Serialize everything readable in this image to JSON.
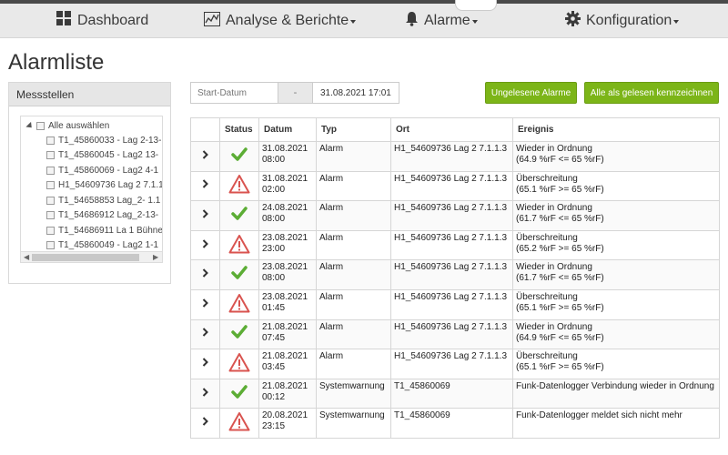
{
  "nav": {
    "dashboard": "Dashboard",
    "analyse": "Analyse & Berichte",
    "alarme": "Alarme",
    "konfiguration": "Konfiguration"
  },
  "page": {
    "title": "Alarmliste"
  },
  "messstellen": {
    "title": "Messstellen",
    "select_all": "Alle auswählen",
    "items": [
      "T1_45860033 - Lag 2-13-",
      "T1_45860045 - Lag2 13-",
      "T1_45860069 - Lag2 4-1",
      "H1_54609736 Lag 2 7.1.1",
      "T1_54658853 Lag_2- 1.1",
      "T1_54686912 Lag_2-13-",
      "T1_54686911 La 1 Bühne",
      "T1_45860049 - Lag2 1-1"
    ]
  },
  "filter": {
    "start_placeholder": "Start-Datum",
    "separator": "-",
    "end_value": "31.08.2021 17:01"
  },
  "buttons": {
    "unread": "Ungelesene Alarme",
    "mark_all": "Alle als gelesen kennzeichnen"
  },
  "table": {
    "headers": [
      "",
      "Status",
      "Datum",
      "Typ",
      "Ort",
      "Ereignis"
    ],
    "rows": [
      {
        "status": "ok",
        "date": "31.08.2021",
        "time": "08:00",
        "type": "Alarm",
        "location": "H1_54609736 Lag 2 7.1.1.3",
        "event1": "Wieder in Ordnung",
        "event2": "(64.9 %rF <= 65 %rF)"
      },
      {
        "status": "warn",
        "date": "31.08.2021",
        "time": "02:00",
        "type": "Alarm",
        "location": "H1_54609736 Lag 2 7.1.1.3",
        "event1": "Überschreitung",
        "event2": "(65.1 %rF >= 65 %rF)"
      },
      {
        "status": "ok",
        "date": "24.08.2021",
        "time": "08:00",
        "type": "Alarm",
        "location": "H1_54609736 Lag 2 7.1.1.3",
        "event1": "Wieder in Ordnung",
        "event2": "(61.7 %rF <= 65 %rF)"
      },
      {
        "status": "warn",
        "date": "23.08.2021",
        "time": "23:00",
        "type": "Alarm",
        "location": "H1_54609736 Lag 2 7.1.1.3",
        "event1": "Überschreitung",
        "event2": "(65.2 %rF >= 65 %rF)"
      },
      {
        "status": "ok",
        "date": "23.08.2021",
        "time": "08:00",
        "type": "Alarm",
        "location": "H1_54609736 Lag 2 7.1.1.3",
        "event1": "Wieder in Ordnung",
        "event2": "(61.7 %rF <= 65 %rF)"
      },
      {
        "status": "warn",
        "date": "23.08.2021",
        "time": "01:45",
        "type": "Alarm",
        "location": "H1_54609736 Lag 2 7.1.1.3",
        "event1": "Überschreitung",
        "event2": "(65.1 %rF >= 65 %rF)"
      },
      {
        "status": "ok",
        "date": "21.08.2021",
        "time": "07:45",
        "type": "Alarm",
        "location": "H1_54609736 Lag 2 7.1.1.3",
        "event1": "Wieder in Ordnung",
        "event2": "(64.9 %rF <= 65 %rF)"
      },
      {
        "status": "warn",
        "date": "21.08.2021",
        "time": "03:45",
        "type": "Alarm",
        "location": "H1_54609736 Lag 2 7.1.1.3",
        "event1": "Überschreitung",
        "event2": "(65.1 %rF >= 65 %rF)"
      },
      {
        "status": "ok",
        "date": "21.08.2021",
        "time": "00:12",
        "type": "Systemwarnung",
        "location": "T1_45860069",
        "event1": "Funk-Datenlogger Verbindung wieder in Ordnung",
        "event2": ""
      },
      {
        "status": "warn",
        "date": "20.08.2021",
        "time": "23:15",
        "type": "Systemwarnung",
        "location": "T1_45860069",
        "event1": "Funk-Datenlogger meldet sich nicht mehr",
        "event2": ""
      }
    ]
  },
  "colors": {
    "accent_green": "#7cb518",
    "ok_green": "#5cad35",
    "warn_red": "#d9534f"
  },
  "icons": {
    "dashboard": "grid-icon",
    "analyse": "chart-icon",
    "alarme": "bell-icon",
    "konfiguration": "gear-icon",
    "expand": "chevron-right-icon",
    "ok": "check-icon",
    "warn": "warning-triangle-icon"
  }
}
